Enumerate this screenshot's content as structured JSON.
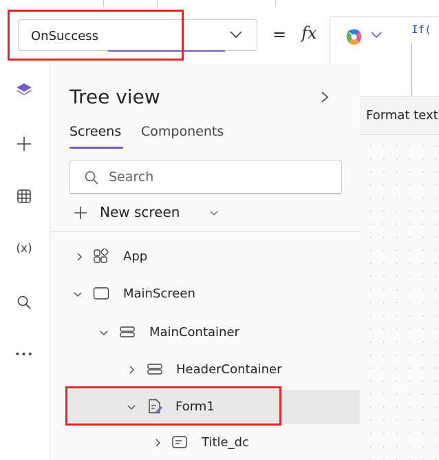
{
  "formula_bar": {
    "property_value": "OnSuccess",
    "equals": "=",
    "fx": "fx",
    "formula_text": "If("
  },
  "format_text": {
    "label": "Format text"
  },
  "rail": {
    "variables_label": "(x)",
    "more_label": "•••"
  },
  "tree_view": {
    "title": "Tree view",
    "tabs": [
      {
        "label": "Screens",
        "selected": true
      },
      {
        "label": "Components",
        "selected": false
      }
    ],
    "search_placeholder": "Search",
    "new_screen_label": "New screen",
    "nodes": [
      {
        "label": "App",
        "expander": "collapsed",
        "icon": "app-icon"
      },
      {
        "label": "MainScreen",
        "expander": "expanded",
        "icon": "screen-icon"
      },
      {
        "label": "MainContainer",
        "expander": "expanded",
        "icon": "container-icon"
      },
      {
        "label": "HeaderContainer",
        "expander": "collapsed",
        "icon": "container-icon"
      },
      {
        "label": "Form1",
        "expander": "expanded",
        "icon": "form-icon",
        "selected": true
      },
      {
        "label": "Title_dc",
        "expander": "collapsed",
        "icon": "datacard-icon"
      }
    ]
  },
  "colors": {
    "accent": "#7a5ac8",
    "highlight_box": "#e3262a",
    "selected_row": "#e8e8e8"
  }
}
